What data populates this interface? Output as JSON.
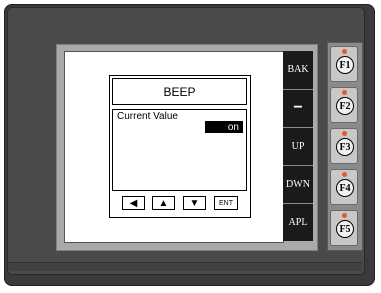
{
  "dialog": {
    "title": "BEEP",
    "field_label": "Current Value",
    "value": "on",
    "buttons": {
      "left": "◀",
      "up": "▲",
      "down": "▼",
      "ent": "ENT"
    }
  },
  "softkeys": [
    "BAK",
    "−",
    "UP",
    "DWN",
    "APL"
  ],
  "fkeys": [
    "F1",
    "F2",
    "F3",
    "F4",
    "F5"
  ],
  "colors": {
    "led": "#e05a2a",
    "device": "#3a3a3a",
    "softkey_bg": "#1a1a1a"
  }
}
